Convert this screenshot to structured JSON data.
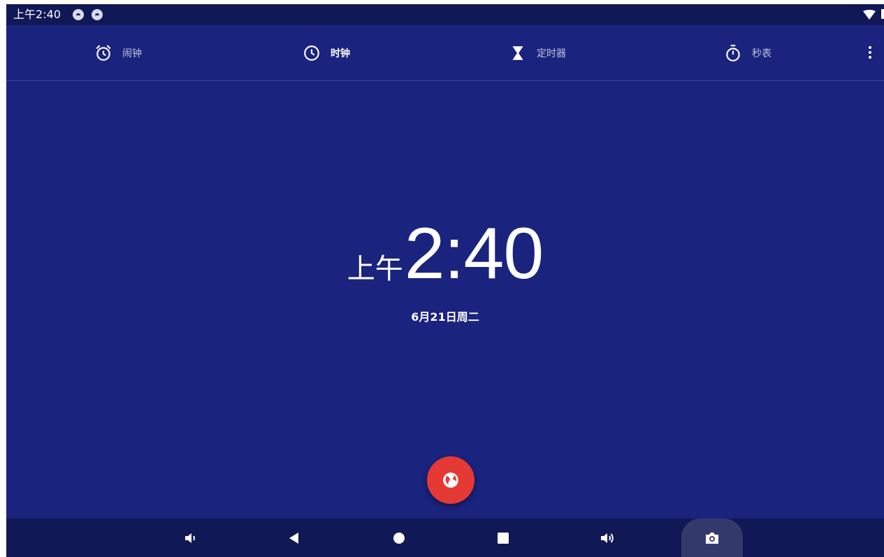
{
  "status_bar": {
    "time": "上午2:40",
    "notification_icons": [
      "android-system-icon",
      "android-system-icon"
    ]
  },
  "tabs": [
    {
      "label": "闹钟",
      "icon": "alarm-clock-icon",
      "active": false
    },
    {
      "label": "时钟",
      "icon": "clock-icon",
      "active": true
    },
    {
      "label": "定时器",
      "icon": "hourglass-icon",
      "active": false
    },
    {
      "label": "秒表",
      "icon": "stopwatch-icon",
      "active": false
    }
  ],
  "more_menu_icon": "more-vert-icon",
  "clock": {
    "ampm": "上午",
    "time": "2:40",
    "date": "6月21日周二"
  },
  "fab": {
    "icon": "globe-icon",
    "color": "#e53935"
  },
  "nav_bar": [
    "volume-down-icon",
    "back-icon",
    "home-icon",
    "recents-icon",
    "volume-up-icon",
    "camera-icon"
  ],
  "colors": {
    "background": "#1a237e",
    "status_bar": "#111856",
    "accent": "#e53935"
  }
}
